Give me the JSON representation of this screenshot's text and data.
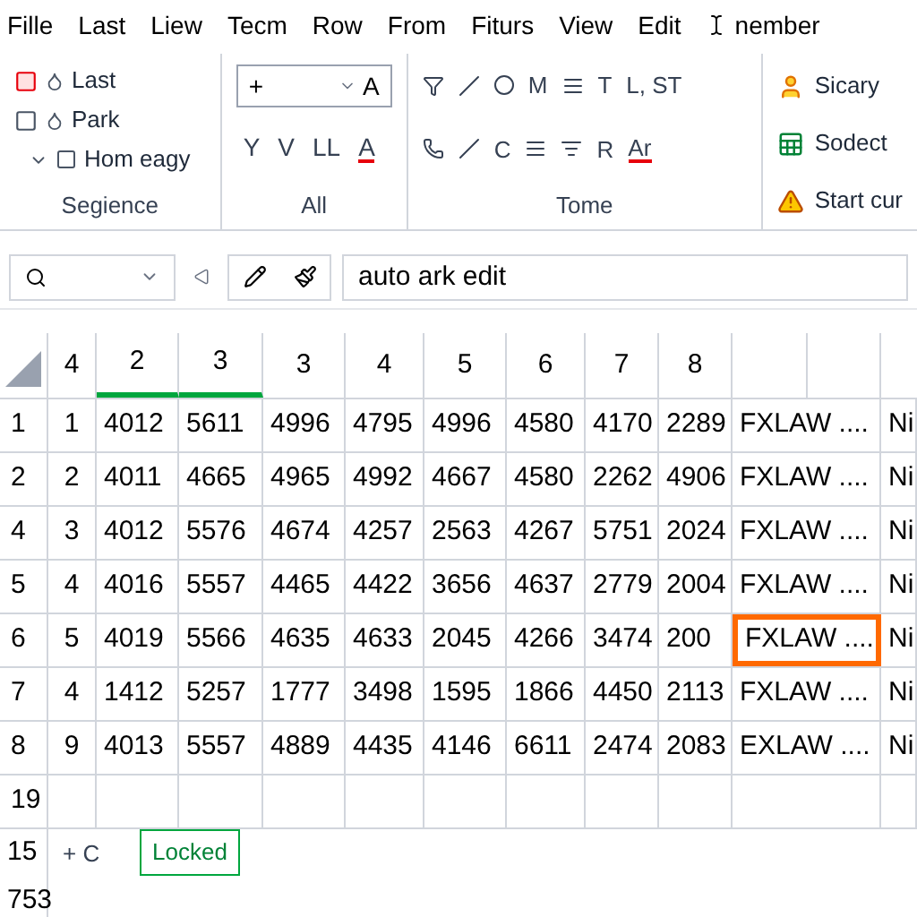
{
  "menu": [
    "Fille",
    "Last",
    "Liew",
    "Tecm",
    "Row",
    "From",
    "Fiturs",
    "View",
    "Edit",
    "nember"
  ],
  "ribbon": {
    "groups": [
      {
        "kind": "list",
        "label": "Segience",
        "items": [
          "Last",
          "Park",
          "Hom eagy"
        ]
      },
      {
        "kind": "font",
        "label": "All",
        "field": {
          "value": "+",
          "suffix": "A"
        },
        "buttons": [
          "Y",
          "V",
          "LL",
          "A"
        ]
      },
      {
        "kind": "tools",
        "label": "Tome",
        "row1": [
          "M",
          "T",
          "L, ST"
        ],
        "row2": [
          "C",
          "R",
          "Ar"
        ]
      },
      {
        "kind": "actions",
        "items": [
          "Sicary",
          "Sodect",
          "Start cur"
        ]
      }
    ]
  },
  "formula_bar": {
    "value": "auto ark edit"
  },
  "table": {
    "columns": [
      "4",
      "2",
      "3",
      "3",
      "4",
      "5",
      "6",
      "7",
      "8"
    ],
    "rows": [
      {
        "header": "1",
        "cells": [
          {
            "text": "1",
            "selected": false
          },
          {
            "text": "4012",
            "selected": false
          },
          {
            "text": "5611",
            "selected": false
          },
          {
            "text": "4996",
            "selected": false
          },
          {
            "text": "4795",
            "selected": false
          },
          {
            "text": "4996",
            "selected": false
          },
          {
            "text": "4580",
            "selected": false
          },
          {
            "text": "4170",
            "selected": false
          },
          {
            "text": "2289",
            "selected": false
          },
          {
            "text": "FXLAW ....",
            "selected": false
          },
          {
            "text": "Ni",
            "selected": false
          }
        ]
      },
      {
        "header": "2",
        "cells": [
          {
            "text": "2",
            "selected": false
          },
          {
            "text": "4011",
            "selected": false
          },
          {
            "text": "4665",
            "selected": false
          },
          {
            "text": "4965",
            "selected": false
          },
          {
            "text": "4992",
            "selected": false
          },
          {
            "text": "4667",
            "selected": false
          },
          {
            "text": "4580",
            "selected": false
          },
          {
            "text": "2262",
            "selected": false
          },
          {
            "text": "4906",
            "selected": false
          },
          {
            "text": "FXLAW ....",
            "selected": false
          },
          {
            "text": "Ni",
            "selected": false
          }
        ]
      },
      {
        "header": "4",
        "cells": [
          {
            "text": "3",
            "selected": false
          },
          {
            "text": "4012",
            "selected": false
          },
          {
            "text": "5576",
            "selected": false
          },
          {
            "text": "4674",
            "selected": false
          },
          {
            "text": "4257",
            "selected": false
          },
          {
            "text": "2563",
            "selected": false
          },
          {
            "text": "4267",
            "selected": false
          },
          {
            "text": "5751",
            "selected": false
          },
          {
            "text": "2024",
            "selected": false
          },
          {
            "text": "FXLAW ....",
            "selected": false
          },
          {
            "text": "Ni",
            "selected": false
          }
        ]
      },
      {
        "header": "5",
        "cells": [
          {
            "text": "4",
            "selected": false
          },
          {
            "text": "4016",
            "selected": false
          },
          {
            "text": "5557",
            "selected": false
          },
          {
            "text": "4465",
            "selected": false
          },
          {
            "text": "4422",
            "selected": false
          },
          {
            "text": "3656",
            "selected": false
          },
          {
            "text": "4637",
            "selected": false
          },
          {
            "text": "2779",
            "selected": false
          },
          {
            "text": "2004",
            "selected": false
          },
          {
            "text": "FXLAW ....",
            "selected": false
          },
          {
            "text": "Ni",
            "selected": false
          }
        ]
      },
      {
        "header": "6",
        "cells": [
          {
            "text": "5",
            "selected": false
          },
          {
            "text": "4019",
            "selected": false
          },
          {
            "text": "5566",
            "selected": false
          },
          {
            "text": "4635",
            "selected": false
          },
          {
            "text": "4633",
            "selected": false
          },
          {
            "text": "2045",
            "selected": false
          },
          {
            "text": "4266",
            "selected": false
          },
          {
            "text": "3474",
            "selected": false
          },
          {
            "text": "200",
            "selected": false
          },
          {
            "text": "FXLAW ....",
            "selected": true
          },
          {
            "text": "Ni",
            "selected": false
          }
        ]
      },
      {
        "header": "7",
        "cells": [
          {
            "text": "4",
            "selected": false
          },
          {
            "text": "1412",
            "selected": false
          },
          {
            "text": "5257",
            "selected": false
          },
          {
            "text": "1777",
            "selected": false
          },
          {
            "text": "3498",
            "selected": false
          },
          {
            "text": "1595",
            "selected": false
          },
          {
            "text": "1866",
            "selected": false
          },
          {
            "text": "4450",
            "selected": false
          },
          {
            "text": "2113",
            "selected": false
          },
          {
            "text": "FXLAW ....",
            "selected": false
          },
          {
            "text": "Ni",
            "selected": false
          }
        ]
      },
      {
        "header": "8",
        "cells": [
          {
            "text": "9",
            "selected": false
          },
          {
            "text": "4013",
            "selected": false
          },
          {
            "text": "5557",
            "selected": false
          },
          {
            "text": "4889",
            "selected": false
          },
          {
            "text": "4435",
            "selected": false
          },
          {
            "text": "4146",
            "selected": false
          },
          {
            "text": "6611",
            "selected": false
          },
          {
            "text": "2474",
            "selected": false
          },
          {
            "text": "2083",
            "selected": false
          },
          {
            "text": "EXLAW ....",
            "selected": false
          },
          {
            "text": "Ni",
            "selected": false
          }
        ]
      },
      {
        "header": "19",
        "cells": []
      }
    ]
  },
  "footer_rows": [
    {
      "header": "15",
      "text": "+ C",
      "tooltip": "Locked"
    },
    {
      "header": "753"
    }
  ]
}
